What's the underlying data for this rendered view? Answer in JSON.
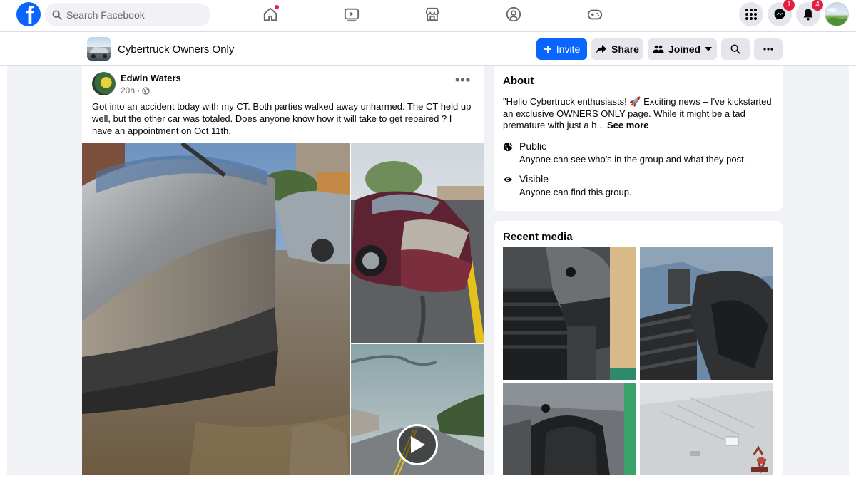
{
  "topnav": {
    "search_placeholder": "Search Facebook",
    "logo_letter": "f",
    "messenger_badge": "1",
    "notifications_badge": "4",
    "icons": [
      "home-icon",
      "watch-icon",
      "marketplace-icon",
      "groups-icon",
      "gaming-icon",
      "menu-grid-icon",
      "messenger-icon",
      "bell-icon"
    ],
    "brand_color": "#0866ff"
  },
  "group": {
    "name": "Cybertruck Owners Only",
    "invite_label": "Invite",
    "share_label": "Share",
    "joined_label": "Joined"
  },
  "post": {
    "author": "Edwin Waters",
    "time": "20h ·",
    "text": "Got into an accident today with my CT. Both parties walked away unharmed. The CT held up well, but the other car was totaled. Does anyone know how it will take to get repaired ? I have an appointment on Oct 11th."
  },
  "about": {
    "title": "About",
    "description": "\"Hello Cybertruck enthusiasts! 🚀 Exciting news – I've kickstarted an exclusive OWNERS ONLY page. While it might be a tad premature with just a h...",
    "see_more": "See more",
    "public_title": "Public",
    "public_sub": "Anyone can see who's in the group and what they post.",
    "visible_title": "Visible",
    "visible_sub": "Anyone can find this group."
  },
  "media": {
    "title": "Recent media"
  }
}
